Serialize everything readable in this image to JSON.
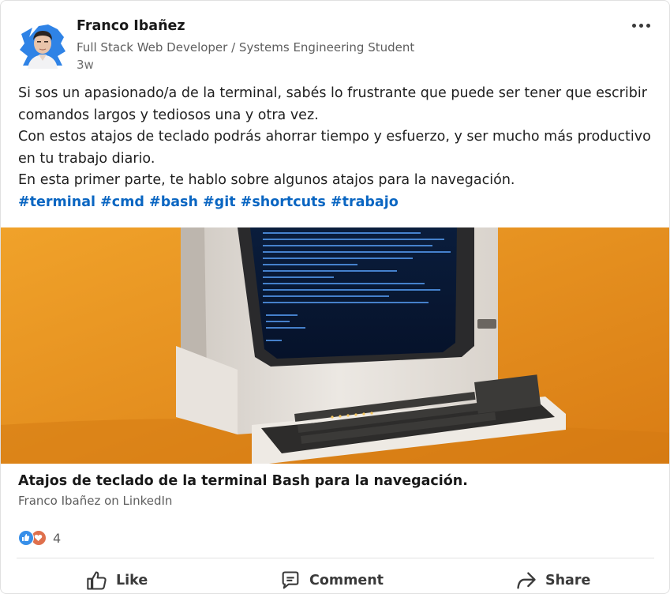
{
  "post": {
    "author": {
      "name": "Franco Ibañez",
      "headline": "Full Stack Web Developer / Systems Engineering Student",
      "age": "3w"
    },
    "body_lines": [
      "Si sos un apasionado/a de la terminal, sabés lo frustrante que puede ser tener que escribir",
      "comandos largos y tediosos una y otra vez.",
      "Con estos atajos de teclado podrás ahorrar tiempo y esfuerzo, y ser mucho más productivo",
      "en tu trabajo diario.",
      "En esta primer parte, te hablo sobre algunos atajos para la navegación."
    ],
    "hashtags": [
      "#terminal",
      "#cmd",
      "#bash",
      "#git",
      "#shortcuts",
      "#trabajo"
    ],
    "article": {
      "title": "Atajos de teclado de la terminal Bash para la navegación.",
      "source": "Franco Ibañez on LinkedIn"
    },
    "reactions": {
      "icons": [
        "like-reaction-icon",
        "love-reaction-icon"
      ],
      "count": "4"
    },
    "actions": {
      "like": "Like",
      "comment": "Comment",
      "share": "Share"
    }
  },
  "colors": {
    "hashtag": "#0a66c2",
    "like_reaction": "#378fe9",
    "love_reaction": "#df704d",
    "image_background": "#e08a1e"
  }
}
